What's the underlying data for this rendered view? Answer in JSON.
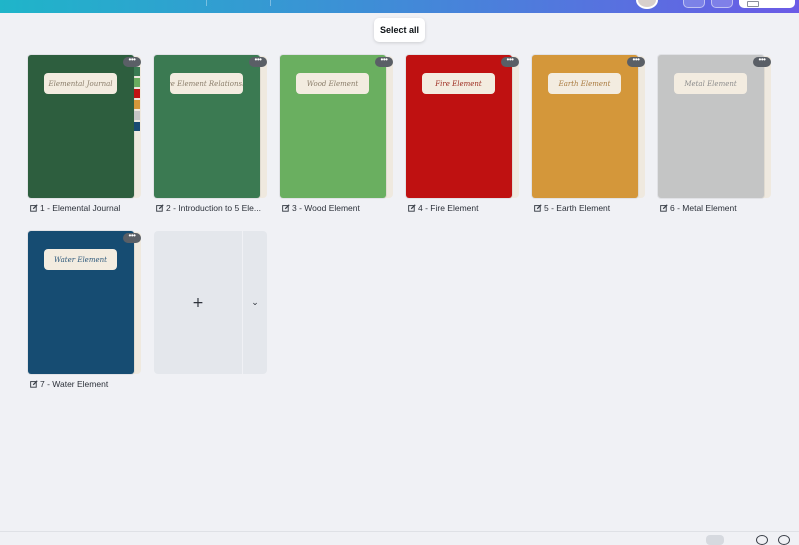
{
  "toolbar": {
    "select_all_label": "Select all"
  },
  "pages": [
    {
      "caption": "1 - Elemental Journal",
      "cover_label": "Elemental Journal",
      "cover_color": "#2d5e3e",
      "label_color": "#8a7d6a",
      "more": "•••",
      "tabs": [
        "#3a7a52",
        "#6aac5f",
        "#bf1313",
        "#d3973a",
        "#c4c5c5",
        "#1a4c73"
      ]
    },
    {
      "caption": "2 - Introduction to 5 Ele...",
      "cover_label": "Five Element Relationship",
      "cover_color": "#3b7a52",
      "label_color": "#8a7d6a",
      "more": "•••"
    },
    {
      "caption": "3 - Wood Element",
      "cover_label": "Wood Element",
      "cover_color": "#6aaf60",
      "label_color": "#8a7d6a",
      "more": "•••"
    },
    {
      "caption": "4 - Fire Element",
      "cover_label": "Fire Element",
      "cover_color": "#bf1111",
      "label_color": "#9c2a1e",
      "more": "•••"
    },
    {
      "caption": "5 - Earth Element",
      "cover_label": "Earth Element",
      "cover_color": "#d4973a",
      "label_color": "#a9793d",
      "more": "•••"
    },
    {
      "caption": "6 - Metal Element",
      "cover_label": "Metal Element",
      "cover_color": "#c4c5c5",
      "label_color": "#8c8c8c",
      "more": "•••"
    },
    {
      "caption": "7 - Water Element",
      "cover_label": "Water Element",
      "cover_color": "#164c72",
      "label_color": "#2f5a7c",
      "more": "•••"
    }
  ],
  "add_page": {
    "plus": "+",
    "chevron": "⌄"
  }
}
